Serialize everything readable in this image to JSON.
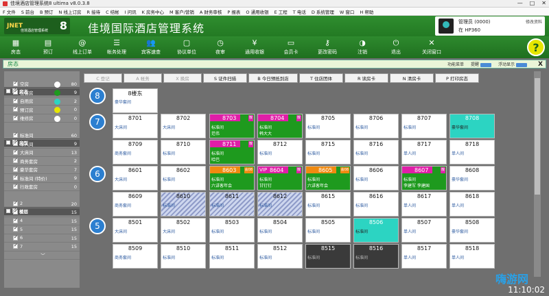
{
  "window": {
    "title": "佳境酒店管理系统8 ultima v8.0.3.8"
  },
  "menu": [
    "F 文件",
    "S 前台",
    "B 预订",
    "N 线上订房",
    "R 接待",
    "C 结帐",
    "I 问讯",
    "K 房务中心",
    "M 客户/营销",
    "A 财务审核",
    "P 报表",
    "O 通用收银",
    "E 工程",
    "T 电话",
    "D 系统管理",
    "W 窗口",
    "H 帮助"
  ],
  "header": {
    "logo_text": "JNET",
    "logo_sub": "佳境酒店管理系统",
    "logo_version": "8",
    "title": "佳境国际酒店管理系统"
  },
  "user": {
    "name": "管理员 (0000)",
    "host": "在 HP360",
    "link": "修改资料"
  },
  "toolbar": [
    {
      "label": "房态",
      "icon": "grid-icon"
    },
    {
      "label": "预订",
      "icon": "calendar-icon"
    },
    {
      "label": "线上订单",
      "icon": "at-icon"
    },
    {
      "label": "帐务处理",
      "icon": "money-icon"
    },
    {
      "label": "宾客速查",
      "icon": "people-icon"
    },
    {
      "label": "协议单位",
      "icon": "document-icon"
    },
    {
      "label": "夜审",
      "icon": "clock-icon"
    },
    {
      "label": "通用收银",
      "icon": "yen-icon"
    },
    {
      "label": "会员卡",
      "icon": "card-icon"
    },
    {
      "label": "更改密码",
      "icon": "key-icon"
    },
    {
      "label": "注销",
      "icon": "logout-icon"
    },
    {
      "label": "退出",
      "icon": "power-icon"
    },
    {
      "label": "关闭窗口",
      "icon": "close-icon"
    }
  ],
  "panel": {
    "title": "房态",
    "opt1": "功能菜单",
    "opt2": "提醒",
    "opt3": "浮动显示",
    "toggle_text": "ON"
  },
  "left": [
    {
      "label": "房态",
      "count": "101",
      "kind": "header"
    },
    {
      "label": "空房",
      "count": "80",
      "color": "#ffffff"
    },
    {
      "label": "住客房",
      "count": "9",
      "color": "#1e9a1e"
    },
    {
      "label": "自用房",
      "count": "2",
      "color": "#2cd4c2"
    },
    {
      "label": "预订房",
      "count": "0",
      "color": "#e6e600"
    },
    {
      "label": "维修房",
      "count": "0",
      "color": "#ffffff"
    },
    {
      "label": "房型",
      "count": "101",
      "kind": "header",
      "toggle": true
    },
    {
      "label": "标准间",
      "count": "60"
    },
    {
      "label": "单人间",
      "count": "9"
    },
    {
      "label": "大床间",
      "count": "13"
    },
    {
      "label": "商务套房",
      "count": "2"
    },
    {
      "label": "豪华套房",
      "count": "7"
    },
    {
      "label": "标准间 (特价)",
      "count": "9"
    },
    {
      "label": "行政套房",
      "count": "0"
    },
    {
      "label": "楼层",
      "count": "101",
      "kind": "header"
    },
    {
      "label": "2",
      "count": "20"
    },
    {
      "label": "3",
      "count": "15"
    },
    {
      "label": "4",
      "count": "15"
    },
    {
      "label": "5",
      "count": "15"
    },
    {
      "label": "6",
      "count": "15"
    },
    {
      "label": "7",
      "count": "15"
    }
  ],
  "actions": [
    {
      "label": "C 登记",
      "disabled": true
    },
    {
      "label": "A 帐务",
      "disabled": true
    },
    {
      "label": "X 换房",
      "disabled": true
    },
    {
      "label": "S 证件扫描",
      "disabled": false
    },
    {
      "label": "B 今日预抵到店",
      "disabled": false
    },
    {
      "label": "T 住店团体",
      "disabled": false
    },
    {
      "label": "R 读房卡",
      "disabled": false
    },
    {
      "label": "N 清房卡",
      "disabled": false
    },
    {
      "label": "P 打印房态",
      "disabled": false
    }
  ],
  "floors": [
    "8",
    "7",
    "6",
    "5"
  ],
  "building": {
    "num": "8楼东",
    "type": "豪华套间"
  },
  "rooms": [
    {
      "num": "8701",
      "type": "大床间",
      "state": "vacant"
    },
    {
      "num": "8702",
      "type": "大床间",
      "state": "vacant"
    },
    {
      "num": "8703",
      "type": "标准间",
      "state": "occupied",
      "bar": "#e01ea8",
      "tag": "散",
      "guest": "范伟"
    },
    {
      "num": "8704",
      "type": "标准间",
      "state": "occupied",
      "bar": "#e01ea8",
      "tag": "散",
      "guest": "韩大大"
    },
    {
      "num": "8705",
      "type": "标准间",
      "state": "vacant"
    },
    {
      "num": "8706",
      "type": "标准间",
      "state": "vacant"
    },
    {
      "num": "8707",
      "type": "标准间",
      "state": "vacant"
    },
    {
      "num": "8708",
      "type": "豪华套间",
      "state": "cleaning"
    },
    {
      "num": "8709",
      "type": "商务套间",
      "state": "vacant"
    },
    {
      "num": "8710",
      "type": "标准间",
      "state": "vacant"
    },
    {
      "num": "8711",
      "type": "标准间",
      "state": "occupied",
      "bar": "#e01ea8",
      "tag": "散",
      "guest": "哈巴"
    },
    {
      "num": "8712",
      "type": "标准间",
      "state": "vacant"
    },
    {
      "num": "8715",
      "type": "标准间",
      "state": "vacant"
    },
    {
      "num": "8716",
      "type": "标准间",
      "state": "vacant"
    },
    {
      "num": "8717",
      "type": "单人间",
      "state": "vacant"
    },
    {
      "num": "8718",
      "type": "单人间",
      "state": "vacant"
    },
    {
      "num": "8601",
      "type": "大床间",
      "state": "vacant"
    },
    {
      "num": "8602",
      "type": "标准间",
      "state": "vacant"
    },
    {
      "num": "8603",
      "type": "标准间",
      "state": "occupied",
      "bar": "#f08a10",
      "tag": "会08",
      "guest": "六讲客年会"
    },
    {
      "num": "8604",
      "type": "标准间",
      "state": "occupied",
      "bar": "#e01ea8",
      "tag": "散",
      "vip": "VIP",
      "guest": "甘钉钉"
    },
    {
      "num": "8605",
      "type": "标准间",
      "state": "occupied",
      "bar": "#f08a10",
      "tag": "会08",
      "guest": "六讲客年会"
    },
    {
      "num": "8606",
      "type": "标准间",
      "state": "vacant"
    },
    {
      "num": "8607",
      "type": "标准间",
      "state": "occupied",
      "bar": "#e01ea8",
      "tag": "散",
      "guest": "李建军 李建国"
    },
    {
      "num": "8608",
      "type": "豪华套间",
      "state": "vacant"
    },
    {
      "num": "8609",
      "type": "商务套间",
      "state": "vacant"
    },
    {
      "num": "8610",
      "type": "标准间",
      "state": "locked"
    },
    {
      "num": "8611",
      "type": "标准间",
      "state": "locked"
    },
    {
      "num": "8612",
      "type": "标准间",
      "state": "locked"
    },
    {
      "num": "8615",
      "type": "标准间",
      "state": "vacant"
    },
    {
      "num": "8616",
      "type": "标准间",
      "state": "vacant"
    },
    {
      "num": "8617",
      "type": "单人间",
      "state": "vacant"
    },
    {
      "num": "8618",
      "type": "单人间",
      "state": "vacant"
    },
    {
      "num": "8501",
      "type": "大床间",
      "state": "vacant"
    },
    {
      "num": "8502",
      "type": "大床间",
      "state": "vacant"
    },
    {
      "num": "8503",
      "type": "标准间",
      "state": "vacant"
    },
    {
      "num": "8504",
      "type": "标准间",
      "state": "vacant"
    },
    {
      "num": "8505",
      "type": "标准间",
      "state": "vacant"
    },
    {
      "num": "8506",
      "type": "标准间",
      "state": "cleaning"
    },
    {
      "num": "8507",
      "type": "单人间",
      "state": "vacant"
    },
    {
      "num": "8508",
      "type": "豪华套间",
      "state": "vacant"
    },
    {
      "num": "8509",
      "type": "商务套间",
      "state": "vacant"
    },
    {
      "num": "8510",
      "type": "标准间",
      "state": "vacant"
    },
    {
      "num": "8511",
      "type": "标准间",
      "state": "vacant"
    },
    {
      "num": "8512",
      "type": "标准间",
      "state": "vacant"
    },
    {
      "num": "8515",
      "type": "标准间",
      "state": "dirty"
    },
    {
      "num": "8516",
      "type": "标准间",
      "state": "dirty"
    },
    {
      "num": "8517",
      "type": "单人间",
      "state": "vacant"
    },
    {
      "num": "8518",
      "type": "单人间",
      "state": "vacant"
    }
  ],
  "clock": "11:10:02",
  "watermark": "嗨游网"
}
